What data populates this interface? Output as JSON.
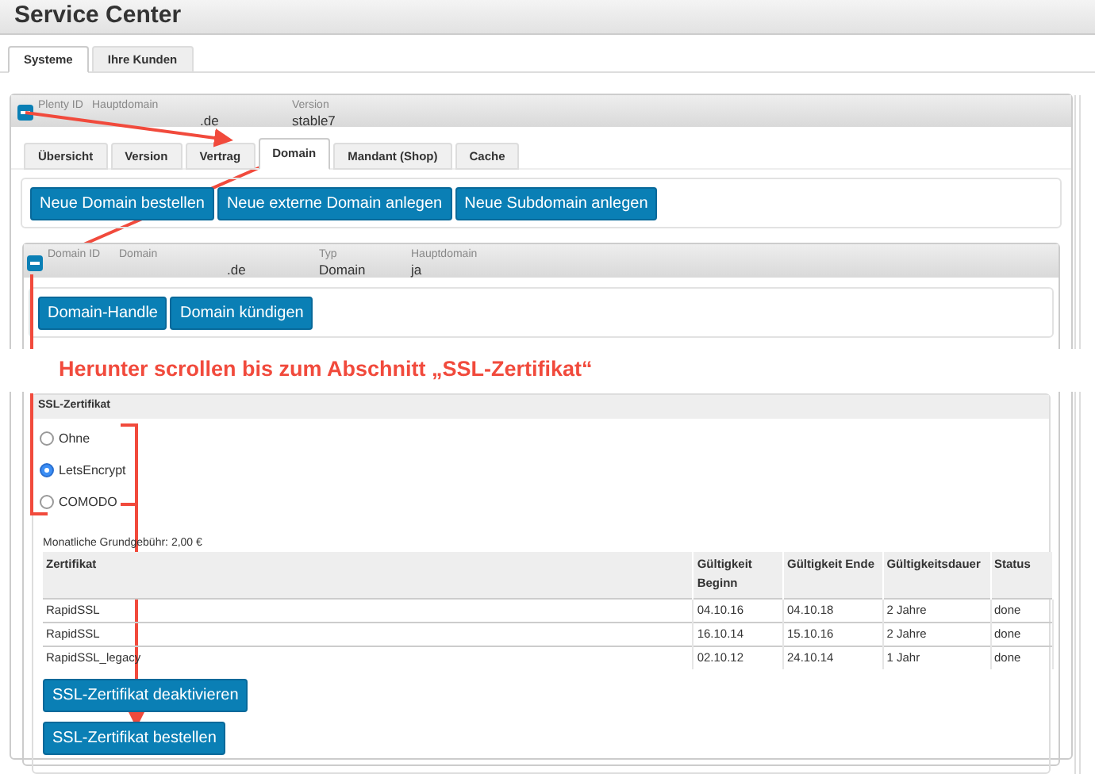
{
  "window": {
    "title": "Service Center"
  },
  "tabs": [
    {
      "label": "Systeme",
      "selected": true
    },
    {
      "label": "Ihre Kunden",
      "selected": false
    }
  ],
  "system": {
    "fields": [
      {
        "label": "Plenty ID"
      },
      {
        "label": "Hauptdomain",
        "value": ".de"
      },
      {
        "label": "Version",
        "value": "stable7"
      }
    ]
  },
  "subtabs": [
    {
      "label": "Übersicht",
      "selected": false
    },
    {
      "label": "Version",
      "selected": false
    },
    {
      "label": "Vertrag",
      "selected": false
    },
    {
      "label": "Domain",
      "selected": true
    },
    {
      "label": "Mandant (Shop)",
      "selected": false
    },
    {
      "label": "Cache",
      "selected": false
    }
  ],
  "domain_buttons": [
    "Neue Domain bestellen",
    "Neue externe Domain anlegen",
    "Neue Subdomain anlegen"
  ],
  "domain": {
    "fields": [
      {
        "label": "Domain ID"
      },
      {
        "label": "Domain",
        "value": ".de"
      },
      {
        "label": "Typ",
        "value": "Domain"
      },
      {
        "label": "Hauptdomain",
        "value": "ja"
      }
    ],
    "buttons": [
      "Domain-Handle",
      "Domain kündigen"
    ]
  },
  "annotation": "Herunter scrollen bis zum Abschnitt „SSL-Zertifikat“",
  "ssl": {
    "title": "SSL-Zertifikat",
    "options": [
      {
        "label": "Ohne",
        "selected": false
      },
      {
        "label": "LetsEncrypt",
        "selected": true
      },
      {
        "label": "COMODO",
        "selected": false
      }
    ],
    "fee": "Monatliche Grundgebühr: 2,00 €",
    "table": {
      "columns": [
        "Zertifikat",
        "Gültigkeit Beginn",
        "Gültigkeit Ende",
        "Gültigkeitsdauer",
        "Status"
      ],
      "rows": [
        [
          "RapidSSL",
          "04.10.16",
          "04.10.18",
          "2 Jahre",
          "done"
        ],
        [
          "RapidSSL",
          "16.10.14",
          "15.10.16",
          "2 Jahre",
          "done"
        ],
        [
          "RapidSSL_legacy",
          "02.10.12",
          "24.10.14",
          "1 Jahr",
          "done"
        ]
      ]
    },
    "buttons": [
      "SSL-Zertifikat deaktivieren",
      "SSL-Zertifikat bestellen"
    ]
  }
}
